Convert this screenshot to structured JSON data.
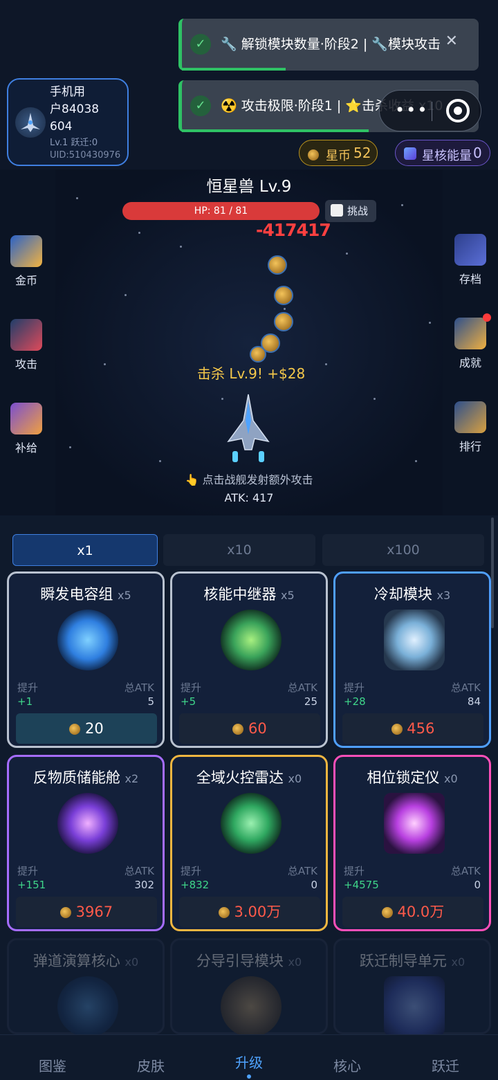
{
  "player": {
    "name_line1": "手机用",
    "name_line2": "户84038",
    "name_line3": "604",
    "level": "Lv.1 跃迁:0",
    "uid": "UID:510430976"
  },
  "toasts": [
    {
      "text": "🔧 解锁模块数量·阶段2 | 🔧模块攻击",
      "close": "✕"
    },
    {
      "text": "☢️ 攻击极限·阶段1 | ⭐击杀收益 x10"
    }
  ],
  "currency": {
    "coin_label": "星币",
    "coin_value": "52",
    "core_label": "星核能量",
    "core_value": "0"
  },
  "boss": {
    "name": "恒星兽 Lv.9",
    "hp": "HP: 81 / 81",
    "hp_fraction": 1.0,
    "challenge": "挑战"
  },
  "battle": {
    "damage": "-417417",
    "kill_text": "击杀 Lv.9! +$28",
    "tap_tip": "👆 点击战舰发射额外攻击",
    "atk": "ATK: 417"
  },
  "side_left": [
    {
      "label": "金币",
      "icon": "coin-stack-icon"
    },
    {
      "label": "攻击",
      "icon": "crossed-swords-icon"
    },
    {
      "label": "补给",
      "icon": "supply-crate-icon"
    }
  ],
  "side_right": [
    {
      "label": "存档",
      "icon": "save-icon"
    },
    {
      "label": "成就",
      "icon": "trophy-icon"
    },
    {
      "label": "排行",
      "icon": "leaderboard-icon"
    }
  ],
  "tabs": [
    "x1",
    "x10",
    "x100"
  ],
  "cards": [
    {
      "name": "瞬发电容组",
      "count": "x5",
      "up_label": "提升",
      "total_label": "总ATK",
      "up": "+1",
      "total": "5",
      "price": "20",
      "border": "#b9c2d0",
      "img": "#2f7fe0"
    },
    {
      "name": "核能中继器",
      "count": "x5",
      "up_label": "提升",
      "total_label": "总ATK",
      "up": "+5",
      "total": "25",
      "price": "60",
      "border": "#b9c2d0",
      "img": "#3aa35a"
    },
    {
      "name": "冷却模块",
      "count": "x3",
      "up_label": "提升",
      "total_label": "总ATK",
      "up": "+28",
      "total": "84",
      "price": "456",
      "border": "#4f9fff",
      "img": "#7ab0d8"
    },
    {
      "name": "反物质储能舱",
      "count": "x2",
      "up_label": "提升",
      "total_label": "总ATK",
      "up": "+151",
      "total": "302",
      "price": "3967",
      "border": "#a56cff",
      "img": "#7a3fd8"
    },
    {
      "name": "全域火控雷达",
      "count": "x0",
      "up_label": "提升",
      "total_label": "总ATK",
      "up": "+832",
      "total": "0",
      "price": "3.00万",
      "border": "#f0b640",
      "img": "#2fa860"
    },
    {
      "name": "相位锁定仪",
      "count": "x0",
      "up_label": "提升",
      "total_label": "总ATK",
      "up": "+4575",
      "total": "0",
      "price": "40.0万",
      "border": "#ff4fb8",
      "img": "#b840e0"
    }
  ],
  "faded_cards": [
    {
      "name": "弹道演算核心",
      "count": "x0"
    },
    {
      "name": "分导引导模块",
      "count": "x0"
    },
    {
      "name": "跃迁制导单元",
      "count": "x0"
    }
  ],
  "nav": [
    "图鉴",
    "皮肤",
    "升级",
    "核心",
    "跃迁"
  ],
  "colors": {
    "accent": "#4fa3ff",
    "hp": "#d93a3a",
    "success": "#2fc265",
    "price_red": "#ff5a4a",
    "gain_green": "#3fd68a"
  }
}
